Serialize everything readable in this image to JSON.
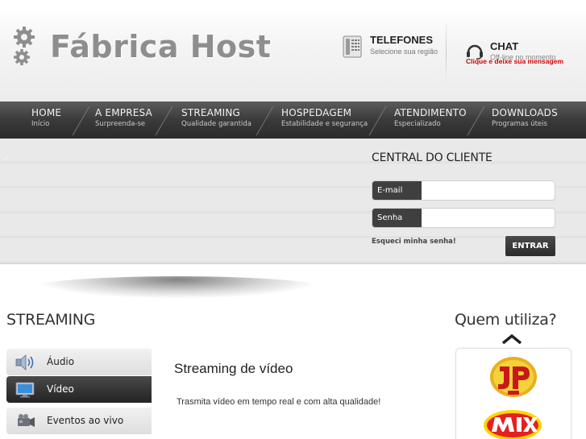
{
  "header": {
    "brand": "Fábrica Host",
    "telefones": {
      "title": "TELEFONES",
      "subtitle": "Selecione sua região"
    },
    "chat": {
      "title": "CHAT",
      "status": "Off-line no momento",
      "message": "Clique e deixe sua mensagem"
    }
  },
  "nav": {
    "items": [
      {
        "label": "HOME",
        "sub": "Início"
      },
      {
        "label": "A EMPRESA",
        "sub": "Surpreenda-se"
      },
      {
        "label": "STREAMING",
        "sub": "Qualidade garantida"
      },
      {
        "label": "HOSPEDAGEM",
        "sub": "Estabilidade e segurança"
      },
      {
        "label": "ATENDIMENTO",
        "sub": "Especializado"
      },
      {
        "label": "DOWNLOADS",
        "sub": "Programas úteis"
      }
    ]
  },
  "client_area": {
    "title": "CENTRAL DO CLIENTE",
    "email_label": "E-mail",
    "email_value": "",
    "senha_label": "Senha",
    "senha_value": "",
    "forgot": "Esqueci minha senha!",
    "submit": "ENTRAR"
  },
  "streaming": {
    "title": "STREAMING",
    "menu": [
      {
        "label": "Áudio",
        "icon": "speaker-icon",
        "active": false
      },
      {
        "label": "Vídeo",
        "icon": "monitor-icon",
        "active": true
      },
      {
        "label": "Eventos ao vivo",
        "icon": "camera-icon",
        "active": false
      }
    ],
    "content_title": "Streaming de vídeo",
    "content_text": "Trasmita vídeo em tempo real e com alta qualidade!"
  },
  "clients": {
    "title": "Quem utiliza?",
    "logos": [
      "jp-fm-logo",
      "mix-fm-logo"
    ]
  },
  "colors": {
    "nav_bg": "#3a3a3a",
    "chat_message": "#d40000",
    "active_menu": "#2b2b2b"
  }
}
